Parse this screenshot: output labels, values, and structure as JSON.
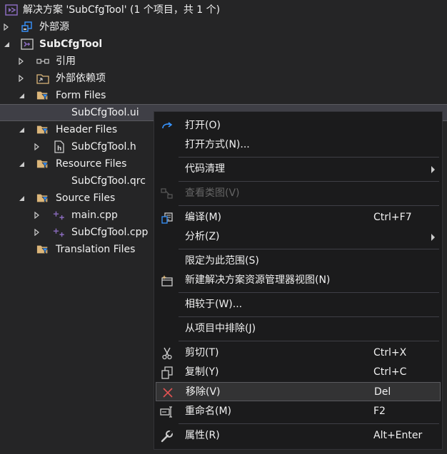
{
  "tree": {
    "solution_label": "解决方案 'SubCfgTool' (1 个项目，共 1 个)",
    "external_sources": "外部源",
    "project": "SubCfgTool",
    "references": "引用",
    "external_deps": "外部依赖项",
    "form_files": "Form Files",
    "ui_file": "SubCfgTool.ui",
    "header_files": "Header Files",
    "h_file": "SubCfgTool.h",
    "resource_files": "Resource Files",
    "qrc_file": "SubCfgTool.qrc",
    "source_files": "Source Files",
    "main_cpp": "main.cpp",
    "sub_cpp": "SubCfgTool.cpp",
    "translation_files": "Translation Files"
  },
  "menu": {
    "open": "打开(O)",
    "open_with": "打开方式(N)...",
    "code_cleanup": "代码清理",
    "view_class_diagram": "查看类图(V)",
    "compile": "编译(M)",
    "compile_shortcut": "Ctrl+F7",
    "analyze": "分析(Z)",
    "scope_to_this": "限定为此范围(S)",
    "new_explorer_view": "新建解决方案资源管理器视图(N)",
    "compare_with": "相较于(W)...",
    "exclude_from_project": "从项目中排除(J)",
    "cut": "剪切(T)",
    "cut_shortcut": "Ctrl+X",
    "copy": "复制(Y)",
    "copy_shortcut": "Ctrl+C",
    "remove": "移除(V)",
    "remove_shortcut": "Del",
    "rename": "重命名(M)",
    "rename_shortcut": "F2",
    "properties": "属性(R)",
    "properties_shortcut": "Alt+Enter"
  },
  "colors": {
    "background": "#252526",
    "menu_background": "#1b1b1c",
    "vs_purple": "#8a6bbe",
    "accent_blue": "#3794ff",
    "folder_yellow": "#dcb67a",
    "remove_red": "#e05252"
  }
}
